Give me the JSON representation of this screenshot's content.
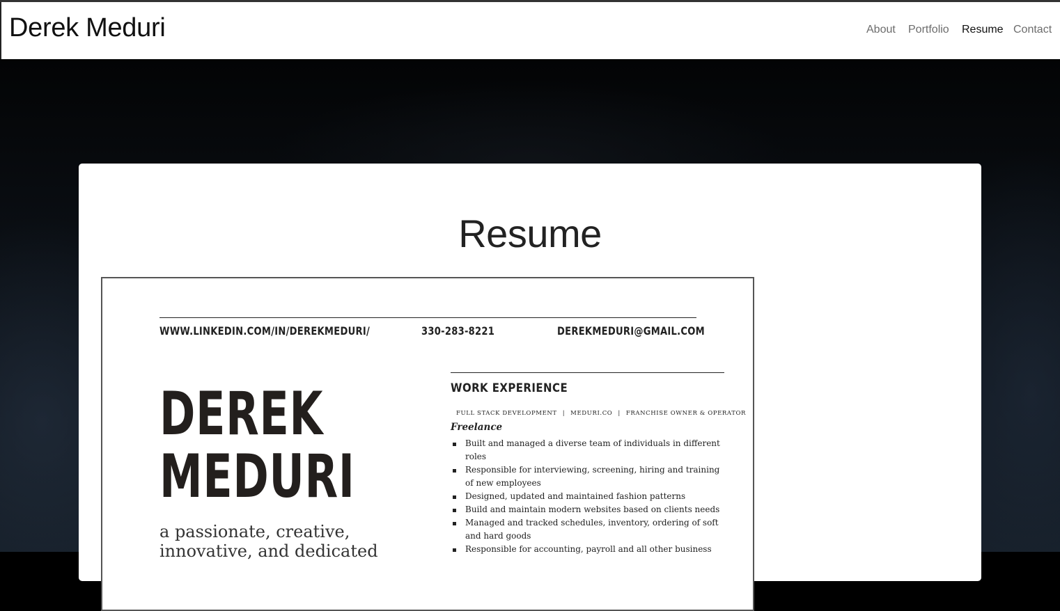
{
  "navbar": {
    "brand": "Derek Meduri",
    "links": [
      {
        "label": "About",
        "active": false
      },
      {
        "label": "Portfolio",
        "active": false
      },
      {
        "label": "Resume",
        "active": true
      },
      {
        "label": "Contact",
        "active": false
      }
    ]
  },
  "page": {
    "title": "Resume"
  },
  "resume": {
    "linkedin": "WWW.LINKEDIN.COM/IN/DEREKMEDURI/",
    "phone": "330-283-8221",
    "email": "DEREKMEDURI@GMAIL.COM",
    "name_line1": "DEREK",
    "name_line2": "MEDURI",
    "tagline_line1": "a passionate, creative,",
    "tagline_line2": "innovative, and dedicated",
    "work_experience": {
      "heading": "WORK EXPERIENCE",
      "meta": [
        "FULL STACK DEVELOPMENT",
        "|",
        "MEDURI.CO",
        "|",
        "FRANCHISE OWNER & OPERATOR"
      ],
      "title": "Freelance",
      "bullets": [
        "Built and managed a diverse team of individuals in different roles",
        "Responsible for interviewing, screening, hiring and training of new employees",
        "Designed, updated and maintained fashion patterns",
        "Build and maintain modern websites based on clients needs",
        "Managed and tracked schedules, inventory, ordering of soft and hard goods",
        "Responsible for accounting, payroll and all other business"
      ]
    }
  },
  "colors": {
    "nav_text": "#6c6c6c",
    "nav_active": "#111111",
    "card_bg": "#ffffff",
    "hero_bg": "#0a0e13"
  }
}
